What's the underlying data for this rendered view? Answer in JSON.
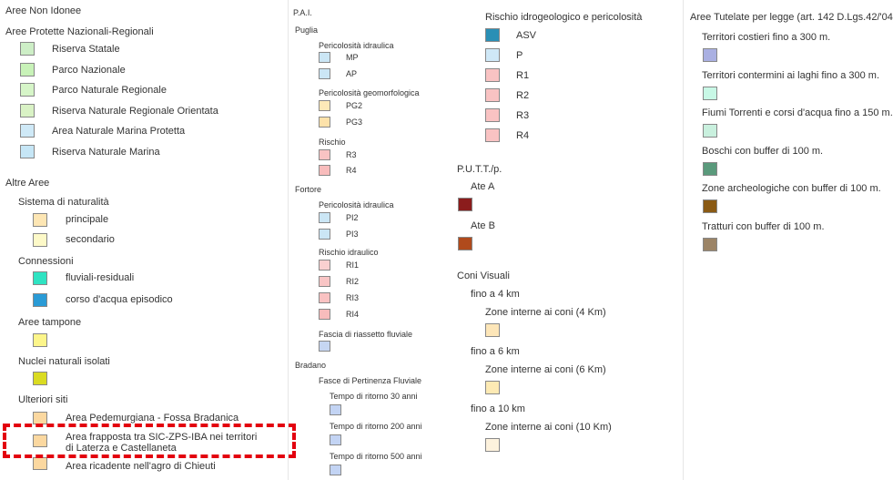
{
  "col1": {
    "title": "Aree Non Idonee",
    "protette_title": "Aree Protette Nazionali-Regionali",
    "protette": [
      {
        "label": "Riserva Statale",
        "color": "#cdeec6"
      },
      {
        "label": "Parco Nazionale",
        "color": "#c8f2b8"
      },
      {
        "label": "Parco Naturale Regionale",
        "color": "#d6f5c8"
      },
      {
        "label": "Riserva Naturale Regionale Orientata",
        "color": "#d9f2c5"
      },
      {
        "label": "Area Naturale Marina Protetta",
        "color": "#cfe9f7"
      },
      {
        "label": "Riserva Naturale Marina",
        "color": "#c6e6f6"
      }
    ],
    "altre_title": "Altre Aree",
    "naturalita_title": "Sistema di naturalità",
    "naturalita": [
      {
        "label": "principale",
        "color": "#fde6b4"
      },
      {
        "label": "secondario",
        "color": "#fdf9c8"
      }
    ],
    "connessioni_title": "Connessioni",
    "connessioni": [
      {
        "label": "fluviali-residuali",
        "color": "#2fe3c2"
      },
      {
        "label": "corso d'acqua episodico",
        "color": "#2a9bd6"
      }
    ],
    "tampone_title": "Aree tampone",
    "tampone_color": "#fcf58a",
    "nuclei_title": "Nuclei naturali isolati",
    "nuclei_color": "#dadb22",
    "ulteriori_title": "Ulteriori siti",
    "ulteriori": [
      {
        "label": "Area Pedemurgiana - Fossa Bradanica",
        "color": "#fbd8a0"
      },
      {
        "label": "Area frapposta tra SIC-ZPS-IBA nei territori",
        "label2": "di Laterza e Castellaneta",
        "color": "#fbd8a0"
      },
      {
        "label": "Area ricadente nell'agro di Chieuti",
        "color": "#fbd8a0"
      }
    ]
  },
  "col2": {
    "title": "P.A.I.",
    "puglia": "Puglia",
    "peric_idraulica_title": "Pericolosità idraulica",
    "peric_idraulica": [
      {
        "label": "MP",
        "color": "#cbe6f5"
      },
      {
        "label": "AP",
        "color": "#cbe6f5"
      }
    ],
    "peric_geo_title": "Pericolosità geomorfologica",
    "peric_geo": [
      {
        "label": "PG2",
        "color": "#fde9b8"
      },
      {
        "label": "PG3",
        "color": "#fde2aa"
      }
    ],
    "rischio_title": "Rischio",
    "rischio": [
      {
        "label": "R3",
        "color": "#f9c3c3"
      },
      {
        "label": "R4",
        "color": "#f8bcbc"
      }
    ],
    "fortore": "Fortore",
    "fortore_peric_title": "Pericolosità idraulica",
    "fortore_peric": [
      {
        "label": "PI2",
        "color": "#cbe6f5"
      },
      {
        "label": "PI3",
        "color": "#cbe6f5"
      }
    ],
    "rischio_idr_title": "Rischio idraulico",
    "rischio_idr": [
      {
        "label": "RI1",
        "color": "#fad0d0"
      },
      {
        "label": "RI2",
        "color": "#f9c5c5"
      },
      {
        "label": "RI3",
        "color": "#f9c2c2"
      },
      {
        "label": "RI4",
        "color": "#f8bcbc"
      }
    ],
    "fascia_title": "Fascia di riassetto fluviale",
    "fascia_color": "#c6d6f2",
    "bradano": "Bradano",
    "fasce_title": "Fasce di Pertinenza Fluviale",
    "tempi": [
      {
        "label": "Tempo di ritorno 30 anni",
        "color": "#c3d4f4"
      },
      {
        "label": "Tempo di ritorno 200 anni",
        "color": "#c3d4f4"
      },
      {
        "label": "Tempo di ritorno 500 anni",
        "color": "#c3d4f4"
      }
    ]
  },
  "col3": {
    "rischio_title": "Rischio idrogeologico e pericolosità",
    "rischio": [
      {
        "label": "ASV",
        "color": "#2a8fb5"
      },
      {
        "label": "P",
        "color": "#cfe8f7"
      },
      {
        "label": "R1",
        "color": "#f9c3c3"
      },
      {
        "label": "R2",
        "color": "#f9c3c3"
      },
      {
        "label": "R3",
        "color": "#f9c3c3"
      },
      {
        "label": "R4",
        "color": "#f9c3c3"
      }
    ],
    "putt_title": "P.U.T.T./p.",
    "ate": [
      {
        "label": "Ate A",
        "color": "#8b1c1c"
      },
      {
        "label": "Ate B",
        "color": "#b04a1c"
      }
    ],
    "coni_title": "Coni Visuali",
    "coni": [
      {
        "title": "fino a 4 km",
        "label": "Zone interne ai coni (4 Km)",
        "color": "#fde6b8"
      },
      {
        "title": "fino a 6 km",
        "label": "Zone interne ai coni (6 Km)",
        "color": "#fdeab4"
      },
      {
        "title": "fino a 10 km",
        "label": "Zone interne ai coni (10 Km)",
        "color": "#fdf2dd"
      }
    ]
  },
  "col4": {
    "title": "Aree Tutelate per legge (art. 142 D.Lgs.42/'04)",
    "items": [
      {
        "label": "Territori costieri fino a 300 m.",
        "color": "#aab0e2"
      },
      {
        "label": "Territori contermini ai laghi fino a 300 m.",
        "color": "#c8f8e6"
      },
      {
        "label": "Fiumi Torrenti e corsi d'acqua fino a 150 m.",
        "color": "#c9f0de"
      },
      {
        "label": "Boschi con buffer di 100 m.",
        "color": "#5a9a7c"
      },
      {
        "label": "Zone archeologiche con buffer di 100 m.",
        "color": "#8a5a14"
      },
      {
        "label": "Tratturi con buffer di 100 m.",
        "color": "#9c8466"
      }
    ]
  }
}
